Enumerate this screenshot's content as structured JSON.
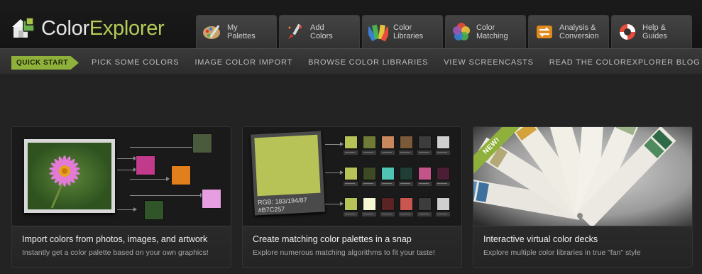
{
  "app": {
    "logo_pre": "Color",
    "logo_post": "Explorer"
  },
  "tabs": [
    {
      "label": "My\nPalettes",
      "icon": "palette-icon"
    },
    {
      "label": "Add\nColors",
      "icon": "paintbrush-icon"
    },
    {
      "label": "Color\nLibraries",
      "icon": "color-fan-icon"
    },
    {
      "label": "Color\nMatching",
      "icon": "color-wheel-icon"
    },
    {
      "label": "Analysis &\nConversion",
      "icon": "convert-arrows-icon"
    },
    {
      "label": "Help &\nGuides",
      "icon": "lifebuoy-icon"
    }
  ],
  "subnav": {
    "quick_start": "QUICK START",
    "links": [
      "PICK SOME COLORS",
      "IMAGE COLOR IMPORT",
      "BROWSE COLOR LIBRARIES",
      "VIEW SCREENCASTS",
      "READ THE COLOREXPLORER BLOG"
    ]
  },
  "cards": [
    {
      "title": "Import colors from photos, images, and artwork",
      "subtitle": "Instantly get a color palette based on your own graphics!",
      "swatches": [
        "#4a5a3c",
        "#c23a8c",
        "#e07f1c",
        "#e69ee0",
        "#2f5528"
      ]
    },
    {
      "title": "Create matching color palettes in a snap",
      "subtitle": "Explore numerous matching algorithms to fit your taste!",
      "rgb_label": "RGB: 183/194/87\n#B7C257",
      "main_color": "#B7C257",
      "rows": [
        [
          "#b7c257",
          "#6f7a35",
          "#c8875c",
          "#7b5a3a",
          "#3c3c3c",
          "#cfcfcf"
        ],
        [
          "#b7c257",
          "#3e4a24",
          "#4fc4b4",
          "#1f3f36",
          "#c2548a",
          "#4a1e34"
        ],
        [
          "#b7c257",
          "#f6f8d4",
          "#5a2424",
          "#c9574f",
          "#3c3c3c",
          "#cfcfcf"
        ]
      ]
    },
    {
      "title": "Interactive virtual color decks",
      "subtitle": "Explore multiple color libraries in true \"fan\" style",
      "badge": "NEW!"
    }
  ],
  "colors": {
    "accent": "#8fb13b",
    "logo_accent": "#b3cc57",
    "background": "#232323"
  }
}
